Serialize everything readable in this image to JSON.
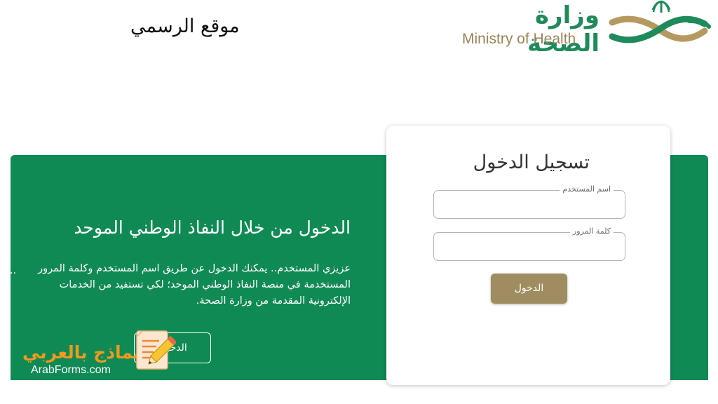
{
  "header": {
    "caption": "موقع الرسمي",
    "logo_ar": "وزارة الصحة",
    "logo_en": "Ministry of Health"
  },
  "nafath": {
    "title": "الدخول من خلال النفاذ الوطني الموحد",
    "description": "عزيزي المستخدم.. يمكنك الدخول عن طريق اسم المستخدم وكلمة المرور المستخدمة في منصة النفاذ الوطني الموحد؛ لكي تستفيد من الخدمات الإلكترونية المقدمة من وزارة الصحة.",
    "dots": "..",
    "button_label": "الدخول"
  },
  "login": {
    "title": "تسجيل الدخول",
    "username_label": "اسم المستخدم",
    "username_value": "",
    "password_label": "كلمة المرور",
    "password_value": "",
    "submit_label": "الدخول"
  },
  "watermark": {
    "text_ar": "نماذج بالعربي",
    "text_en": "ArabForms.com"
  },
  "colors": {
    "green": "#0f8a55",
    "gold": "#9f8c60",
    "brand_green": "#1f8a5b",
    "brand_gold": "#9a8358",
    "watermark_orange": "#f19a1f"
  }
}
